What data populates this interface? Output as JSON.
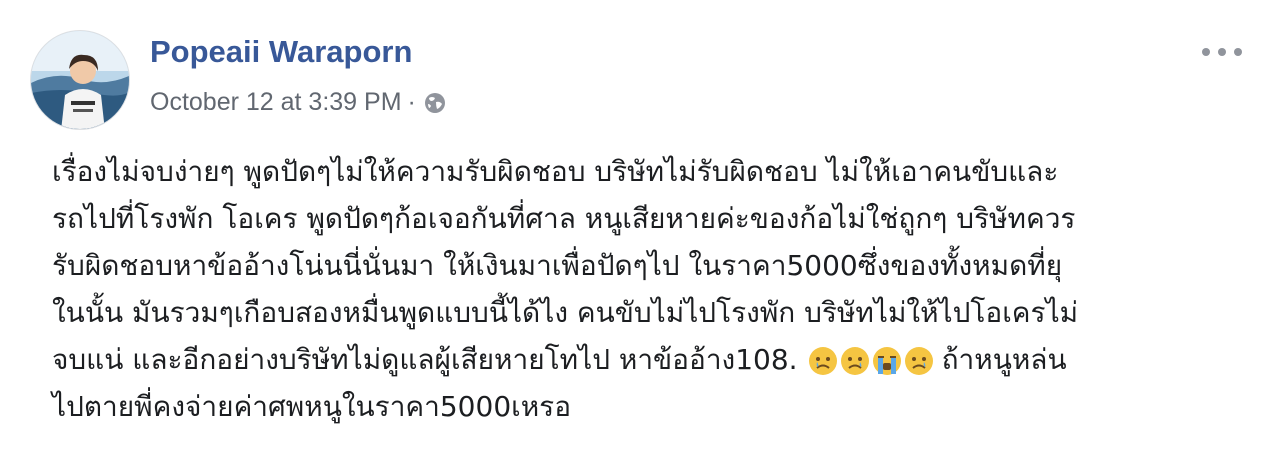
{
  "post": {
    "author": "Popeaii Waraporn",
    "timestamp": "October 12 at 3:39 PM",
    "separator": "·",
    "privacy_icon": "globe-icon",
    "more_icon": "ellipsis-icon",
    "text_lines": [
      "เรื่องไม่จบง่ายๆ พูดปัดๆไม่ให้ความรับผิดชอบ บริษัทไม่รับผิดชอบ ไม่ให้เอาคนขับและ",
      "รถไปที่โรงพัก โอเคร พูดปัดๆก้อเจอกันที่ศาล หนูเสียหายค่ะของก้อไม่ใช่ถูกๆ บริษัทควร",
      "รับผิดชอบหาข้ออ้างโน่นนี่นั่นมา ให้เงินมาเพื่อปัดๆไป ในราคา5000ซึ่งของทั้งหมดที่ยุ",
      "ในนั้น มันรวมๆเกือบสองหมื่นพูดแบบนี้ได้ไง คนขับไม่ไปโรงพัก บริษัทไม่ให้ไปโอเครไม่"
    ],
    "line5_before_emoji": "จบแน่ และอีกอย่างบริษัทไม่ดูแลผู้เสียหายโทไป หาข้ออ้าง108.",
    "line5_after_emoji": "ถ้าหนูหล่น",
    "line6": "ไปตายพี่คงจ่ายค่าศพหนูในราคา5000เหรอ",
    "emojis": [
      "sad-face-emoji",
      "sad-face-emoji",
      "crying-face-emoji",
      "sad-face-emoji"
    ]
  },
  "colors": {
    "author": "#385898",
    "meta": "#616770",
    "text": "#1c1e21",
    "emoji": "#f5c542"
  }
}
